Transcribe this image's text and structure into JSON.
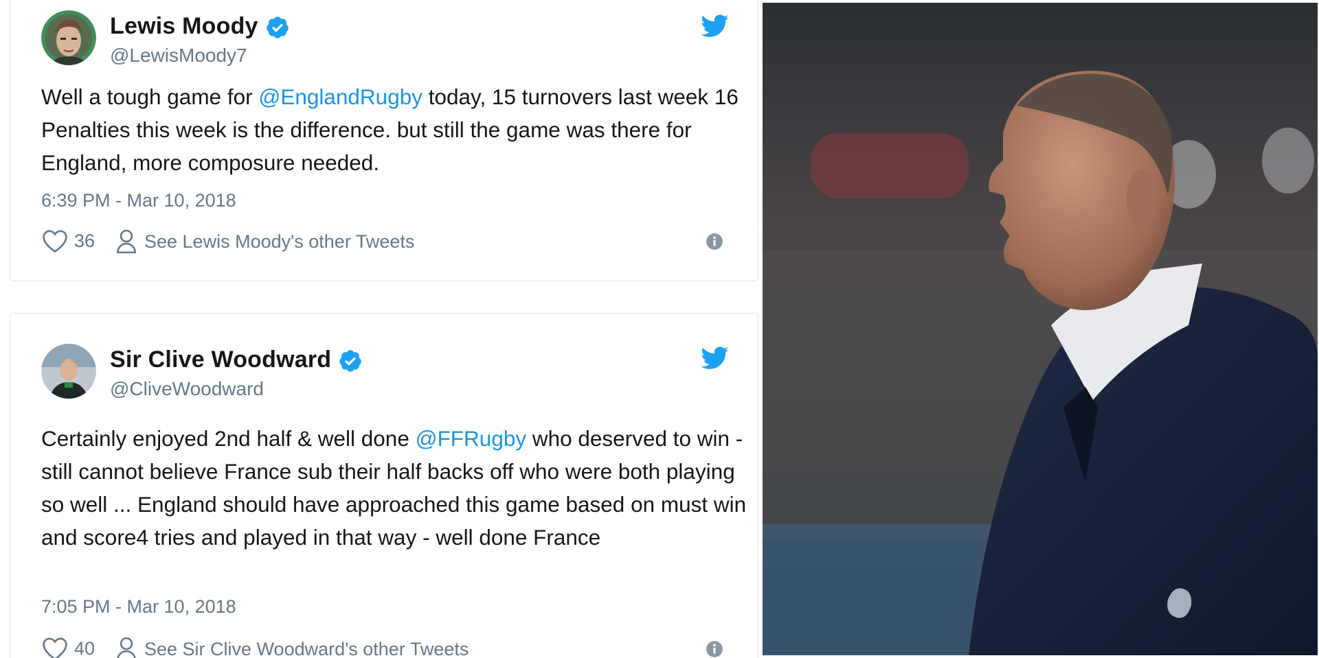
{
  "tweets": [
    {
      "display_name": "Lewis Moody",
      "handle": "@LewisMoody7",
      "text_before": "Well a tough game for ",
      "mention": "@EnglandRugby",
      "text_after": " today, 15 turnovers last week 16 Penalties this week is the difference. but still the game was there for England, more composure needed.",
      "timestamp": "6:39 PM - Mar 10, 2018",
      "likes": "36",
      "others_label": "See Lewis Moody's other Tweets"
    },
    {
      "display_name": "Sir Clive Woodward",
      "handle": "@CliveWoodward",
      "text_before": "Certainly enjoyed 2nd half & well done ",
      "mention": "@FFRugby",
      "text_after": " who deserved to win -  still cannot believe France sub their half backs off who were both playing so well ... England   should have approached this game based on must win and score4 tries and played in that way - well done France",
      "timestamp": "7:05 PM - Mar 10, 2018",
      "likes": "40",
      "others_label": "See Sir Clive Woodward's other Tweets"
    }
  ],
  "icons": {
    "verified": "verified-badge-icon",
    "bird": "twitter-bird-icon",
    "like": "heart-icon",
    "profile": "person-icon",
    "info": "info-icon"
  },
  "colors": {
    "twitter_blue": "#1da1f2",
    "mention": "#1b95e0",
    "meta_text": "#657786",
    "card_border": "#e1e8ed"
  }
}
